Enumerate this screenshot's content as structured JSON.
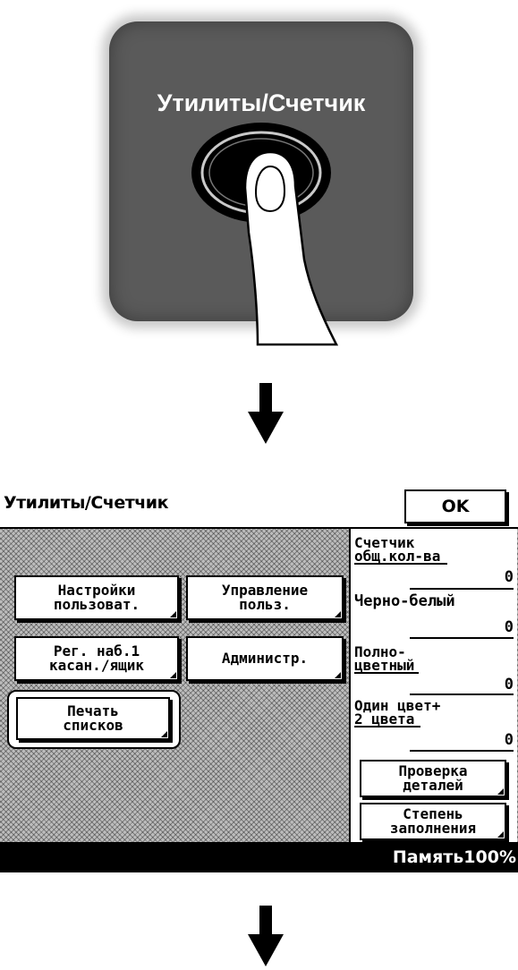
{
  "physical_key": {
    "label": "Утилиты/Счетчик"
  },
  "screen": {
    "title": "Утилиты/Счетчик",
    "ok_label": "OK",
    "buttons": {
      "user_settings": [
        "Настройки",
        "пользоват."
      ],
      "user_management": [
        "Управление",
        "польз."
      ],
      "one_touch_box": [
        "Рег. наб.1",
        "касан./ящик"
      ],
      "admin": [
        "Администр."
      ],
      "print_lists": [
        "Печать",
        "списков"
      ],
      "check_details": [
        "Проверка",
        "деталей"
      ],
      "coverage": [
        "Степень",
        "заполнения"
      ]
    },
    "counters": {
      "total": {
        "label_line1": "Счетчик",
        "label_line2": "общ.кол-ва",
        "value": "0"
      },
      "black": {
        "label_line1": "Черно-белый",
        "value": "0"
      },
      "full_color": {
        "label_line1": "Полно-",
        "label_line2": "цветный",
        "value": "0"
      },
      "single_two": {
        "label_line1": "Один цвет+",
        "label_line2": "2 цвета",
        "value": "0"
      }
    },
    "status": {
      "memory": "Память100%"
    }
  },
  "arrows": [
    "down-arrow-icon",
    "down-arrow-icon"
  ]
}
